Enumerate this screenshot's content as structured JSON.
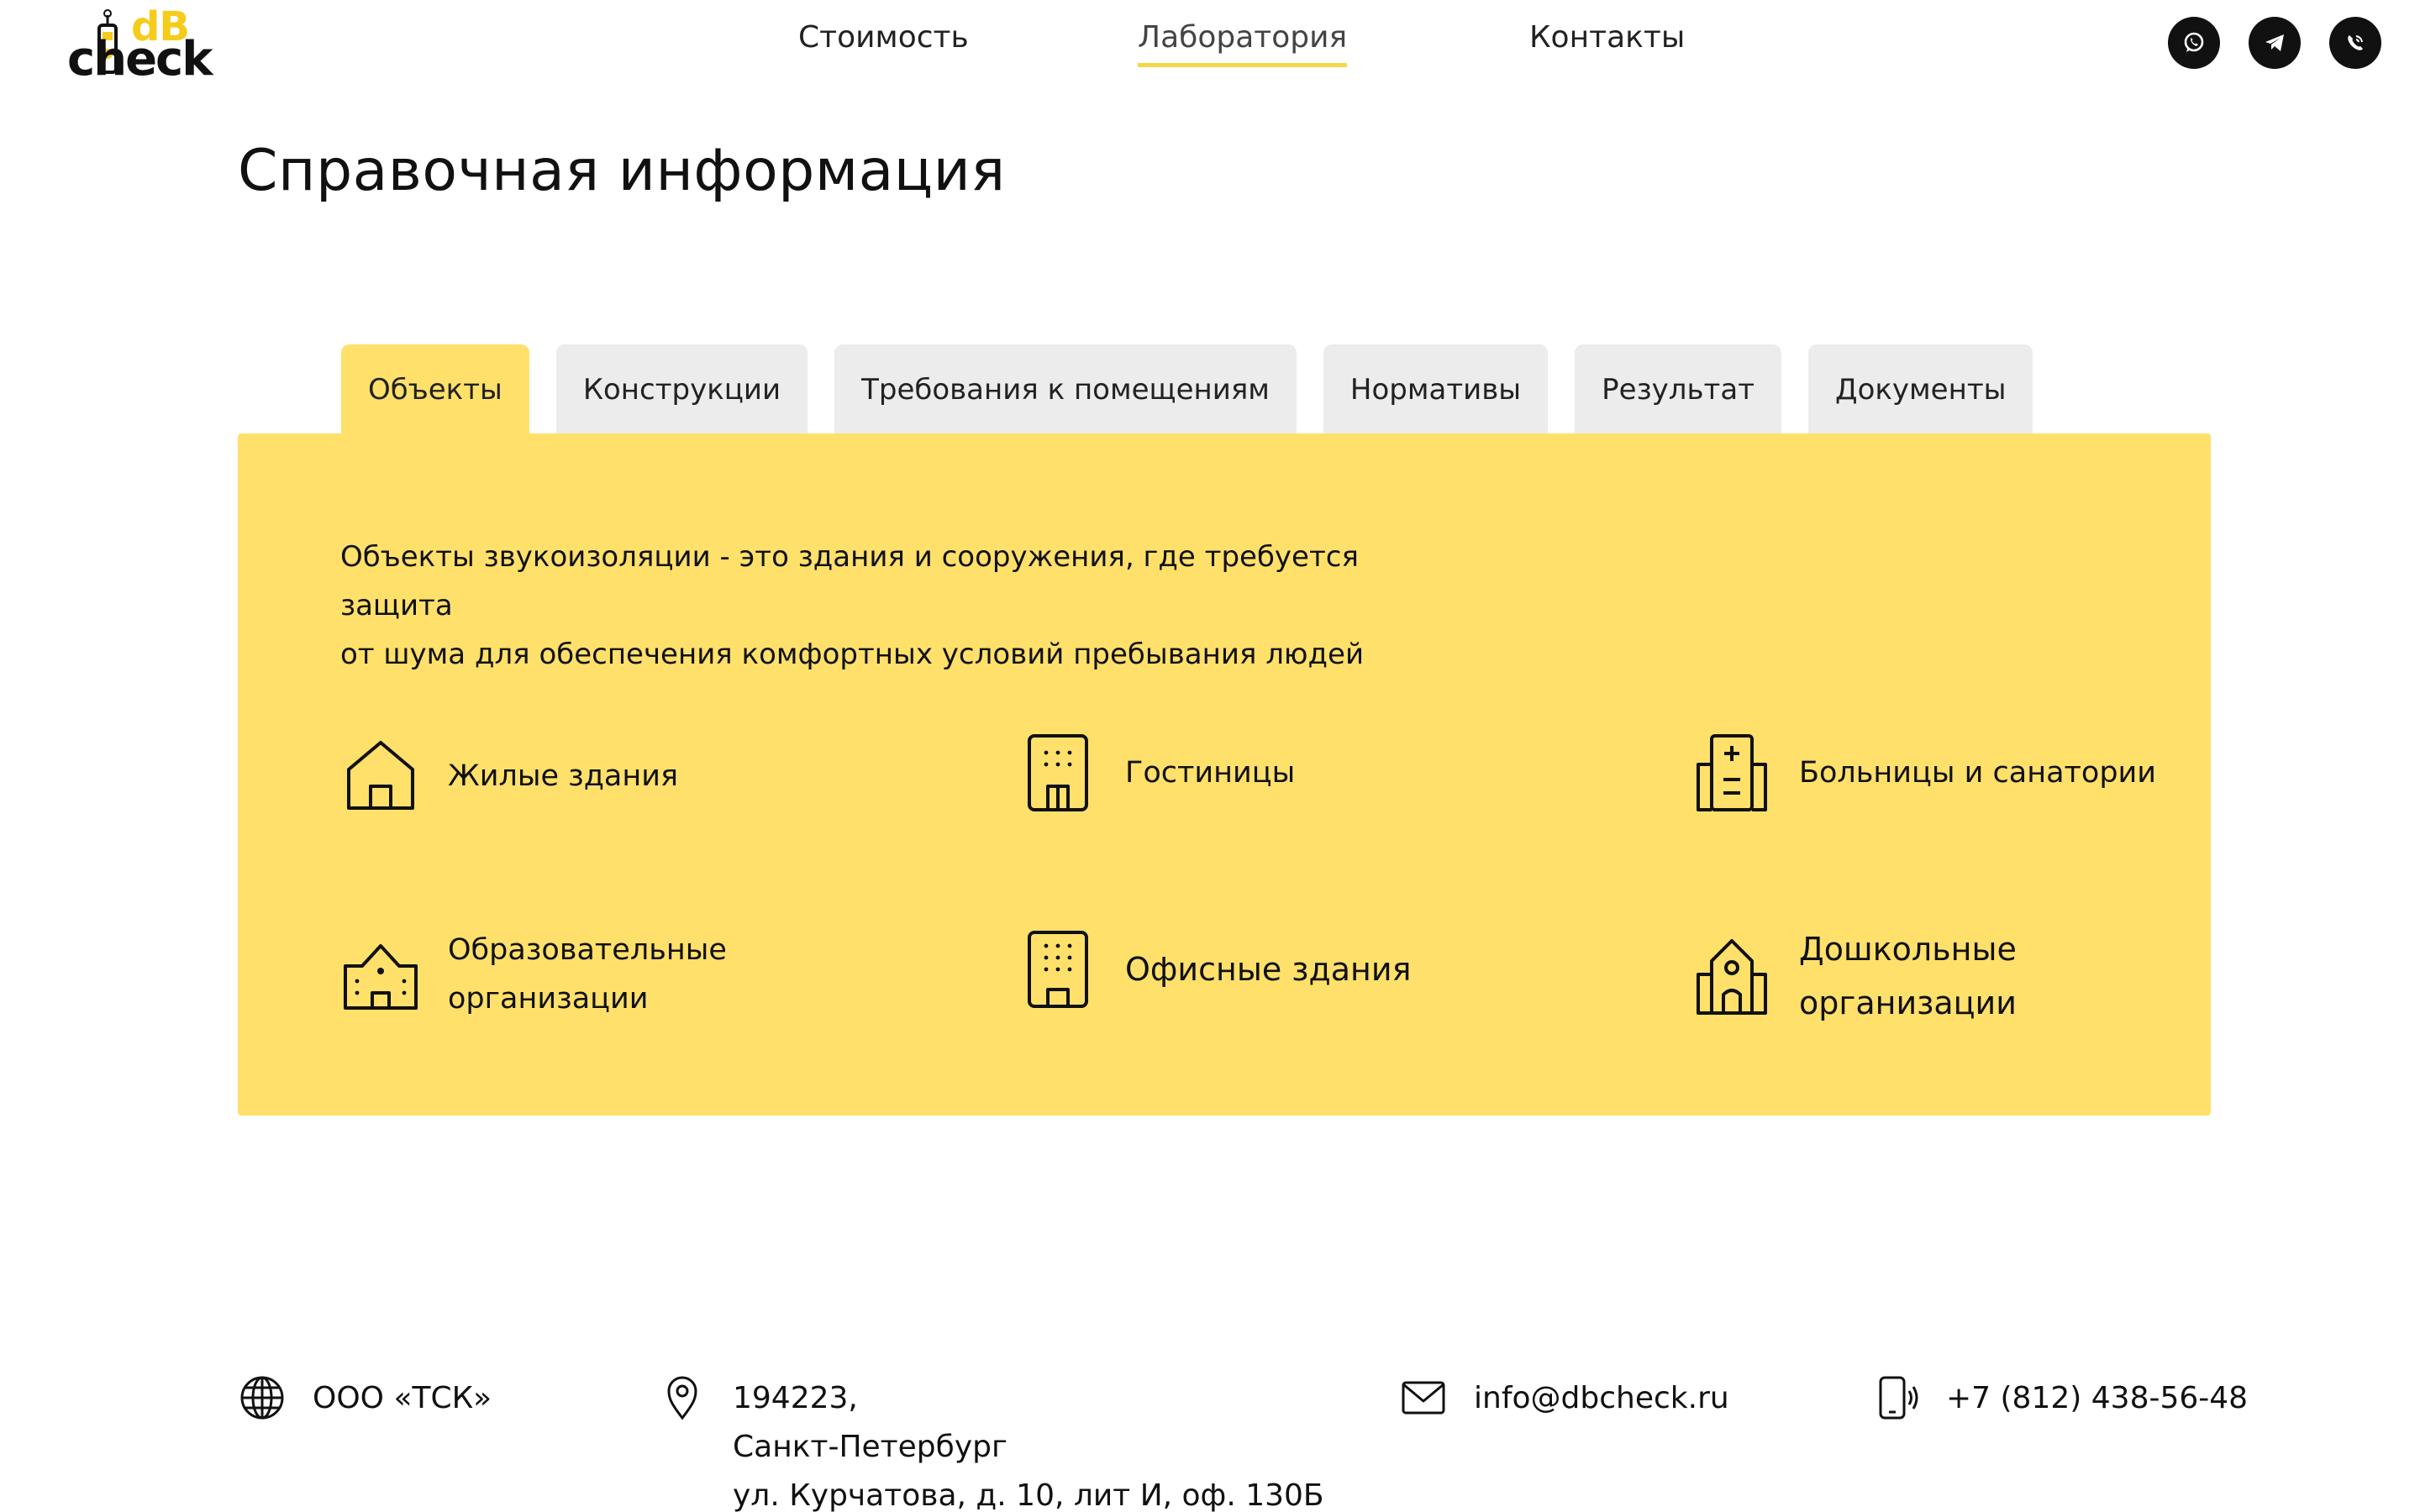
{
  "brand": {
    "logo_db": "dB",
    "logo_check": "check"
  },
  "nav": {
    "items": [
      {
        "label": "Стоимость"
      },
      {
        "label": "Лаборатория"
      },
      {
        "label": "Контакты"
      }
    ]
  },
  "social": {
    "icons": [
      "whatsapp-icon",
      "telegram-icon",
      "viber-icon"
    ]
  },
  "page": {
    "title": "Справочная информация"
  },
  "tabs": [
    {
      "label": "Объекты"
    },
    {
      "label": "Конструкции"
    },
    {
      "label": "Требования к помещениям"
    },
    {
      "label": "Нормативы"
    },
    {
      "label": "Результат"
    },
    {
      "label": "Документы"
    }
  ],
  "panel": {
    "intro_line1": "Объекты звукоизоляции - это здания и сооружения, где требуется защита",
    "intro_line2": "от шума для обеспечения комфортных условий пребывания людей",
    "objects": [
      {
        "label": "Жилые здания",
        "icon": "house-icon"
      },
      {
        "label": "Гостиницы",
        "icon": "hotel-icon"
      },
      {
        "label": "Больницы и санатории",
        "icon": "hospital-icon"
      },
      {
        "label_line1": "Образовательные",
        "label_line2": "организации",
        "icon": "school-icon"
      },
      {
        "label": "Офисные здания",
        "icon": "office-icon"
      },
      {
        "label_line1": "Дошкольные",
        "label_line2": "организации",
        "icon": "kindergarten-icon"
      }
    ]
  },
  "footer": {
    "company": "ООО «ТСК»",
    "address_line1": "194223,",
    "address_line2": "Санкт-Петербург",
    "address_line3": "ул. Курчатова, д. 10, лит И, оф. 130Б",
    "email": "info@dbcheck.ru",
    "phone": "+7 (812) 438-56-48"
  },
  "colors": {
    "accent": "#ffe06b",
    "tab_inactive": "#ececec",
    "nav_underline": "#f5d84a",
    "text": "#111111"
  }
}
